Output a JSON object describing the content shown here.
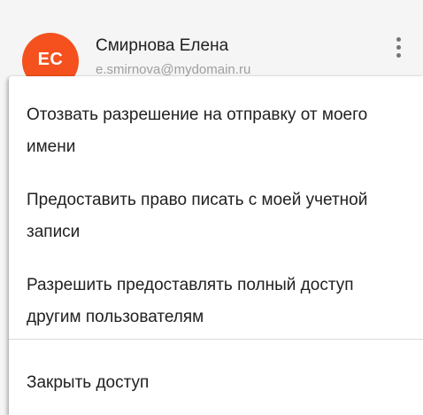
{
  "user": {
    "initials": "ЕС",
    "name": "Смирнова Елена",
    "email": "e.smirnova@mydomain.ru",
    "avatar_color": "#f4511e",
    "more_icon": "more-vert-icon"
  },
  "menu": {
    "items": [
      {
        "label": "Отозвать разрешение на отправку от моего имени"
      },
      {
        "label": "Предоставить право писать с моей учетной записи"
      },
      {
        "label": "Разрешить предоставлять полный доступ другим пользователям"
      },
      {
        "label": "Закрыть доступ"
      }
    ]
  }
}
